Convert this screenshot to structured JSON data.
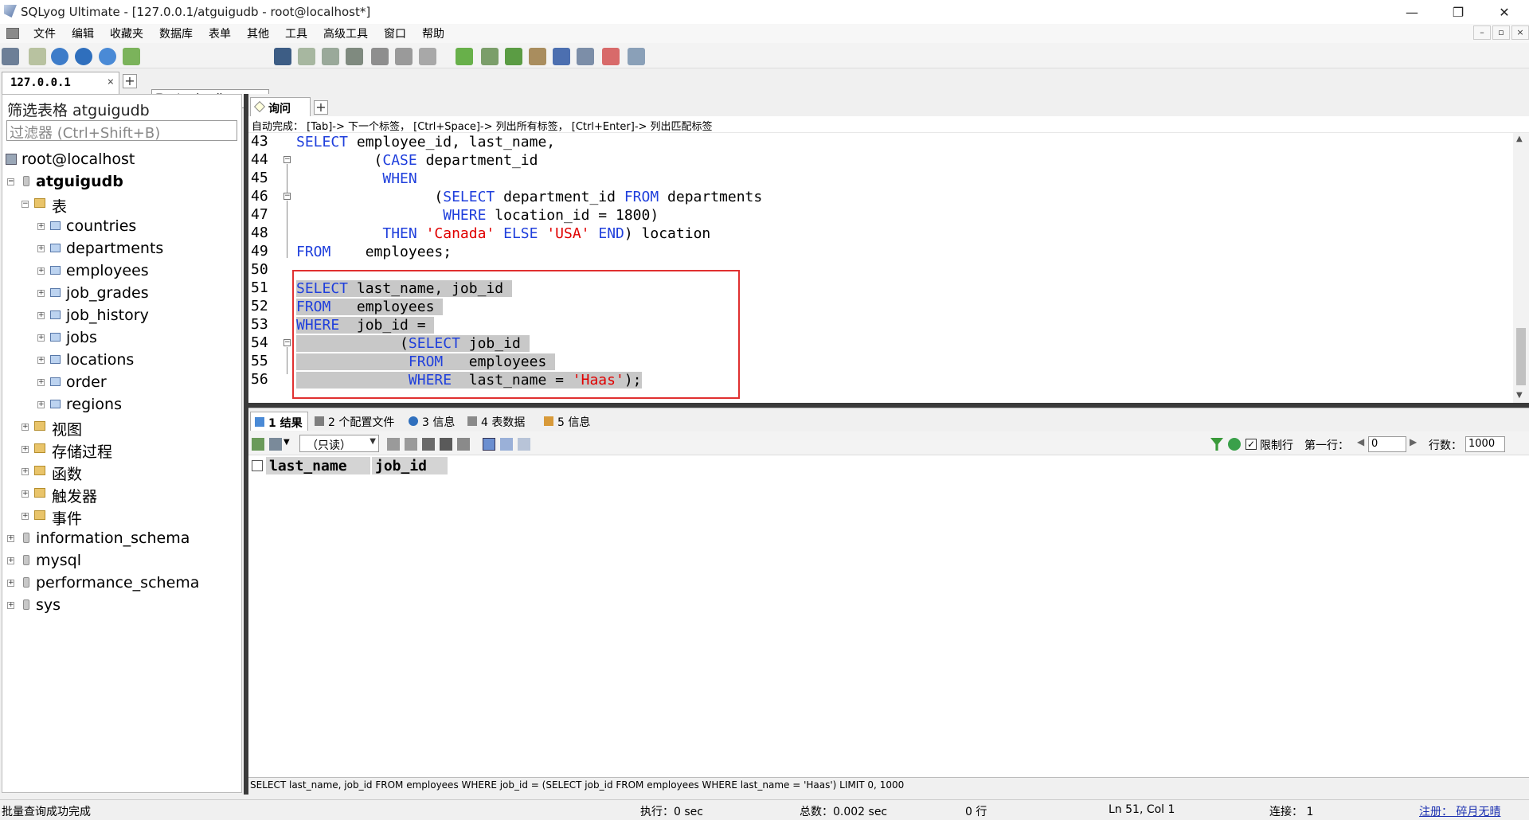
{
  "window": {
    "title": "SQLyog Ultimate - [127.0.0.1/atguigudb - root@localhost*]",
    "min": "—",
    "max": "❐",
    "close": "✕"
  },
  "menu": [
    "文件",
    "编辑",
    "收藏夹",
    "数据库",
    "表单",
    "其他",
    "工具",
    "高级工具",
    "窗口",
    "帮助"
  ],
  "toolbar": {
    "db_select": "atguigudb"
  },
  "conn_tab": {
    "label": "127.0.0.1",
    "close": "×",
    "add": "+"
  },
  "left": {
    "filter_title": "筛选表格 atguigudb",
    "filter_placeholder": "过滤器 (Ctrl+Shift+B)",
    "server": "root@localhost",
    "db": "atguigudb",
    "tables_folder": "表",
    "tables": [
      "countries",
      "departments",
      "employees",
      "job_grades",
      "job_history",
      "jobs",
      "locations",
      "order",
      "regions"
    ],
    "folders": [
      "视图",
      "存储过程",
      "函数",
      "触发器",
      "事件"
    ],
    "other_dbs": [
      "information_schema",
      "mysql",
      "performance_schema",
      "sys"
    ]
  },
  "editor": {
    "tab_label": "询问",
    "tab_add": "+",
    "autocomplete_hint": "自动完成： [Tab]-> 下一个标签， [Ctrl+Space]-> 列出所有标签， [Ctrl+Enter]-> 列出匹配标签",
    "line_numbers": [
      "43",
      "44",
      "45",
      "46",
      "47",
      "48",
      "49",
      "50",
      "51",
      "52",
      "53",
      "54",
      "55",
      "56"
    ]
  },
  "results": {
    "tabs": [
      "1 结果",
      "2 个配置文件",
      "3 信息",
      "4 表数据",
      "5 信息"
    ],
    "readonly": "（只读）",
    "limit_label": "限制行",
    "first_row_label": "第一行：",
    "first_row_value": "0",
    "rows_label": "行数：",
    "rows_value": "1000",
    "columns": [
      "last_name",
      "job_id"
    ],
    "sql": "SELECT last_name, job_id FROM employees WHERE job_id = (SELECT job_id FROM employees WHERE last_name = 'Haas') LIMIT 0, 1000"
  },
  "status": {
    "message": "批量查询成功完成",
    "exec": "执行：0 sec",
    "total": "总数：0.002 sec",
    "rows": "0 行",
    "position": "Ln 51, Col 1",
    "connections": "连接： 1",
    "register": "注册： 碎月无晴"
  },
  "colors": {
    "keyword": "#1f3fdc",
    "string": "#e00000",
    "highlight_box": "#e03030",
    "selection": "#c8c8c8"
  }
}
